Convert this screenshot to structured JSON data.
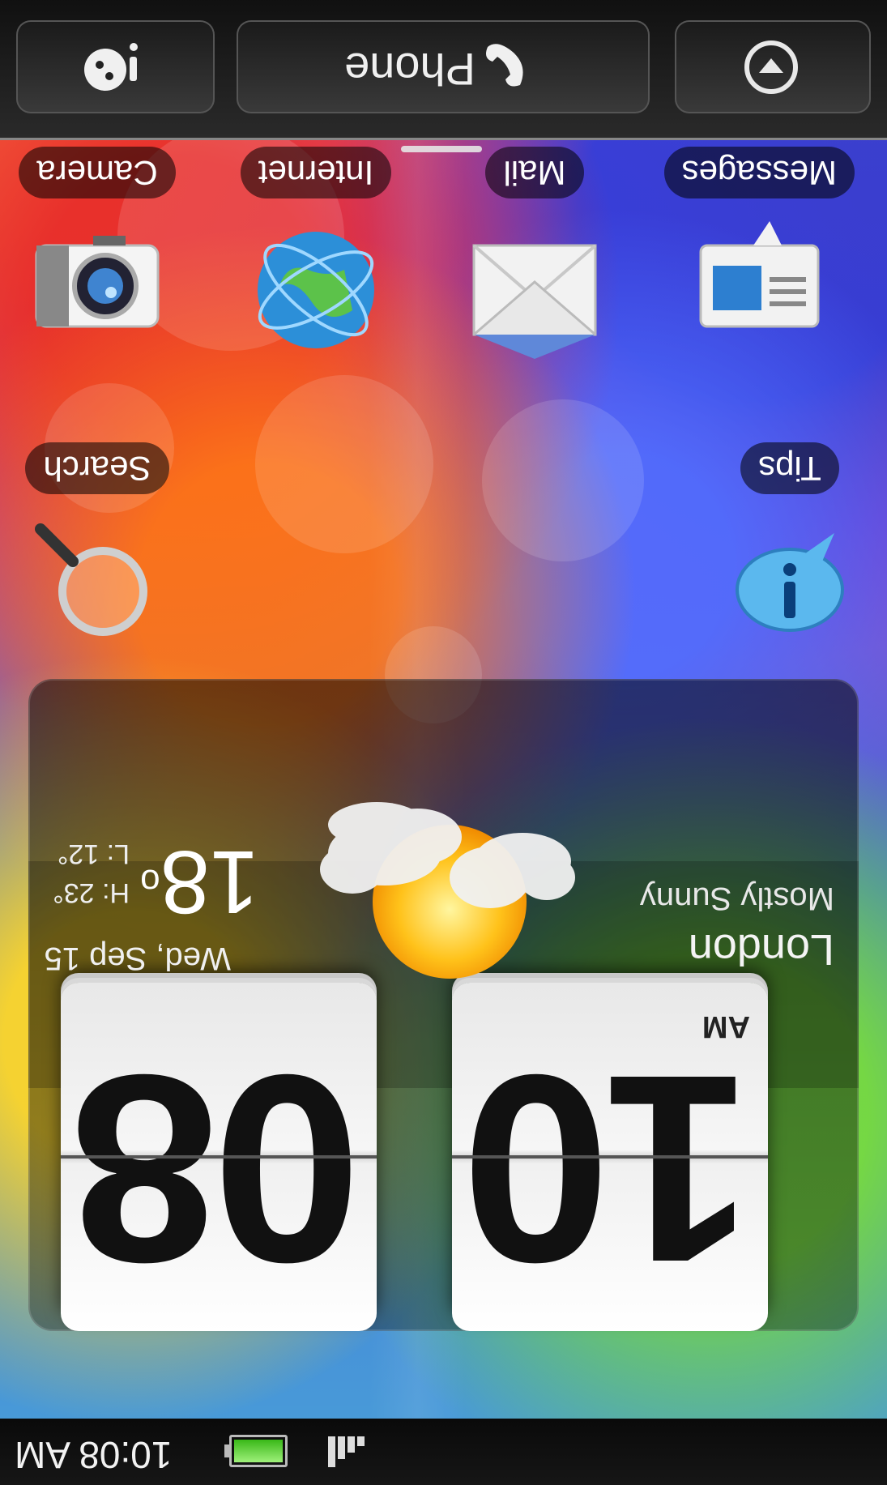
{
  "status_bar": {
    "time": "10:08 AM",
    "battery_icon": "battery-icon",
    "battery_color": "#39b818",
    "signal_icon": "signal-icon"
  },
  "clock": {
    "hour": "10",
    "minute": "08",
    "ampm": "AM"
  },
  "weather": {
    "city": "London",
    "condition": "Mostly Sunny",
    "date": "Wed, Sep 15",
    "temperature": "18",
    "degree_symbol": "o",
    "high": "H: 23°",
    "low": "L: 12°",
    "icon": "partly-sunny-icon"
  },
  "apps": [
    {
      "label": "Search",
      "icon": "search-icon"
    },
    {
      "label": "Tips",
      "icon": "tips-icon"
    },
    {
      "label": "Camera",
      "icon": "camera-icon"
    },
    {
      "label": "Internet",
      "icon": "globe-icon"
    },
    {
      "label": "Mail",
      "icon": "mail-icon"
    },
    {
      "label": "Messages",
      "icon": "messages-icon"
    }
  ],
  "dock": {
    "left_icon": "personalize-icon",
    "phone_label": "Phone",
    "phone_icon": "phone-icon",
    "right_icon": "all-apps-arrow-icon"
  },
  "colors": {
    "label_bg": "rgba(0,0,0,0.55)",
    "dock": "#1a1a1a"
  }
}
